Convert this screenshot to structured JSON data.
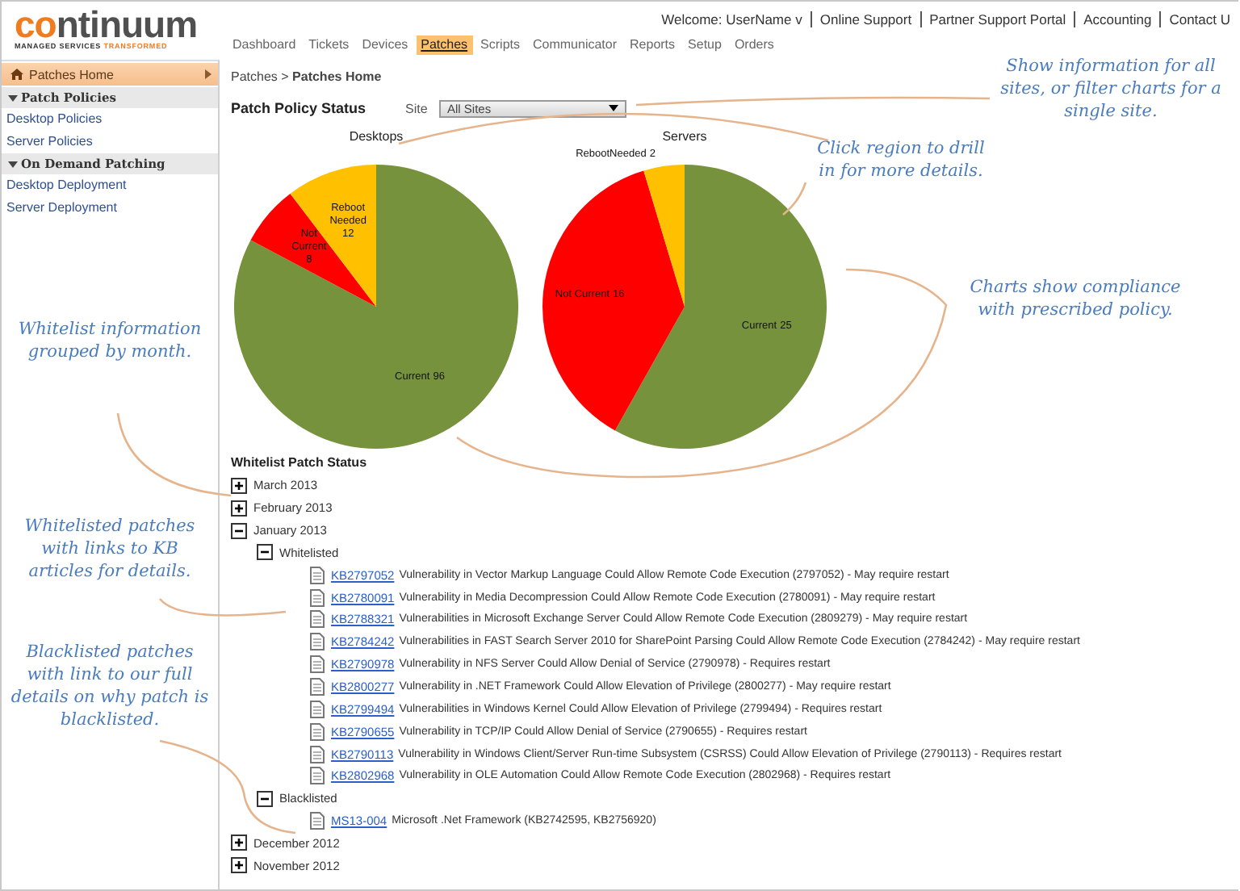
{
  "logo": {
    "wordmark": "**co**ntinuum",
    "tagline": "MANAGED SERVICES **TRANSFORMED**"
  },
  "top_links": [
    "Welcome: UserName v",
    "Online Support",
    "Partner Support Portal",
    "Accounting",
    "Contact U"
  ],
  "nav": [
    {
      "label": "Dashboard",
      "selected": false
    },
    {
      "label": "Tickets",
      "selected": false
    },
    {
      "label": "Devices",
      "selected": false
    },
    {
      "label": "Patches",
      "selected": true
    },
    {
      "label": "Scripts",
      "selected": false
    },
    {
      "label": "Communicator",
      "selected": false
    },
    {
      "label": "Reports",
      "selected": false
    },
    {
      "label": "Setup",
      "selected": false
    },
    {
      "label": "Orders",
      "selected": false
    }
  ],
  "sidebar": {
    "home": {
      "label": "Patches Home",
      "selected": true
    },
    "sections": [
      {
        "title": "Patch Policies",
        "expanded": true,
        "items": [
          {
            "label": "Desktop Policies",
            "selected": false
          },
          {
            "label": "Server Policies",
            "selected": false
          }
        ]
      },
      {
        "title": "On Demand Patching",
        "expanded": true,
        "items": [
          {
            "label": "Desktop Deployment",
            "selected": false
          },
          {
            "label": "Server Deployment",
            "selected": false
          }
        ]
      }
    ]
  },
  "breadcrumb": "Patches > **Patches Home**",
  "status": {
    "title": "Patch Policy Status",
    "site_label": "Site",
    "site_value": "All Sites"
  },
  "charts": [
    {
      "chart_data": {
        "type": "pie",
        "title": "Desktops",
        "categories": [
          "Current",
          "Not Current",
          "Reboot Needed"
        ],
        "values": [
          96,
          8,
          12
        ],
        "data_labels": true
      }
    },
    {
      "chart_data": {
        "type": "pie",
        "title": "Servers",
        "categories": [
          "Current",
          "Not Current",
          "RebootNeeded"
        ],
        "values": [
          25,
          16,
          2
        ],
        "data_labels": true
      }
    }
  ],
  "whitelist": {
    "title": "Whitelist Patch Status",
    "tree": [
      {
        "kind": "group",
        "label": "March 2013",
        "expanded": false
      },
      {
        "kind": "group",
        "label": "February 2013",
        "expanded": false
      },
      {
        "kind": "group",
        "label": "January 2013",
        "expanded": true,
        "children": [
          {
            "kind": "group",
            "label": "Whitelisted",
            "expanded": true,
            "children": [
              {
                "kind": "patch",
                "link": "KB2797052",
                "text": "Vulnerability in Vector Markup Language Could Allow Remote Code Execution (2797052) - May require restart"
              },
              {
                "kind": "patch",
                "link": "KB2780091",
                "text": "Vulnerability in Media Decompression Could Allow Remote Code Execution (2780091) - May require restart"
              },
              {
                "kind": "patch",
                "link": "KB2788321",
                "text": "Vulnerabilities in Microsoft Exchange Server Could Allow Remote Code Execution (2809279) - May require restart"
              },
              {
                "kind": "patch",
                "link": "KB2784242",
                "text": "Vulnerabilities in FAST Search Server 2010 for SharePoint Parsing Could Allow Remote Code Execution (2784242) - May require restart"
              },
              {
                "kind": "patch",
                "link": "KB2790978",
                "text": "Vulnerability in NFS Server Could Allow Denial of Service (2790978) - Requires restart"
              },
              {
                "kind": "patch",
                "link": "KB2800277",
                "text": "Vulnerability in .NET Framework Could Allow Elevation of Privilege (2800277) - May require restart"
              },
              {
                "kind": "patch",
                "link": "KB2799494",
                "text": "Vulnerabilities in Windows Kernel Could Allow Elevation of Privilege (2799494) - Requires restart"
              },
              {
                "kind": "patch",
                "link": "KB2790655",
                "text": "Vulnerability in TCP/IP Could Allow Denial of Service (2790655) - Requires restart"
              },
              {
                "kind": "patch",
                "link": "KB2790113",
                "text": "Vulnerability in Windows Client/Server Run-time Subsystem (CSRSS) Could Allow Elevation of Privilege (2790113) - Requires restart"
              },
              {
                "kind": "patch",
                "link": "KB2802968",
                "text": "Vulnerability in OLE Automation Could Allow Remote Code Execution (2802968) - Requires restart"
              }
            ]
          },
          {
            "kind": "group",
            "label": "Blacklisted",
            "expanded": true,
            "children": [
              {
                "kind": "patch",
                "link": "MS13-004",
                "text": "Microsoft .Net Framework (KB2742595, KB2756920)"
              }
            ]
          }
        ]
      },
      {
        "kind": "group",
        "label": "December 2012",
        "expanded": false
      },
      {
        "kind": "group",
        "label": "November 2012",
        "expanded": false
      }
    ]
  },
  "callouts": [
    "Show information for all sites, or filter charts for a single site.",
    "Click region to drill in for more details.",
    "Charts show compliance with prescribed policy.",
    "Whitelist information grouped by month.",
    "Whitelisted patches with links to KB articles for details.",
    "Blacklisted patches with link to our full details on why patch is blacklisted."
  ]
}
